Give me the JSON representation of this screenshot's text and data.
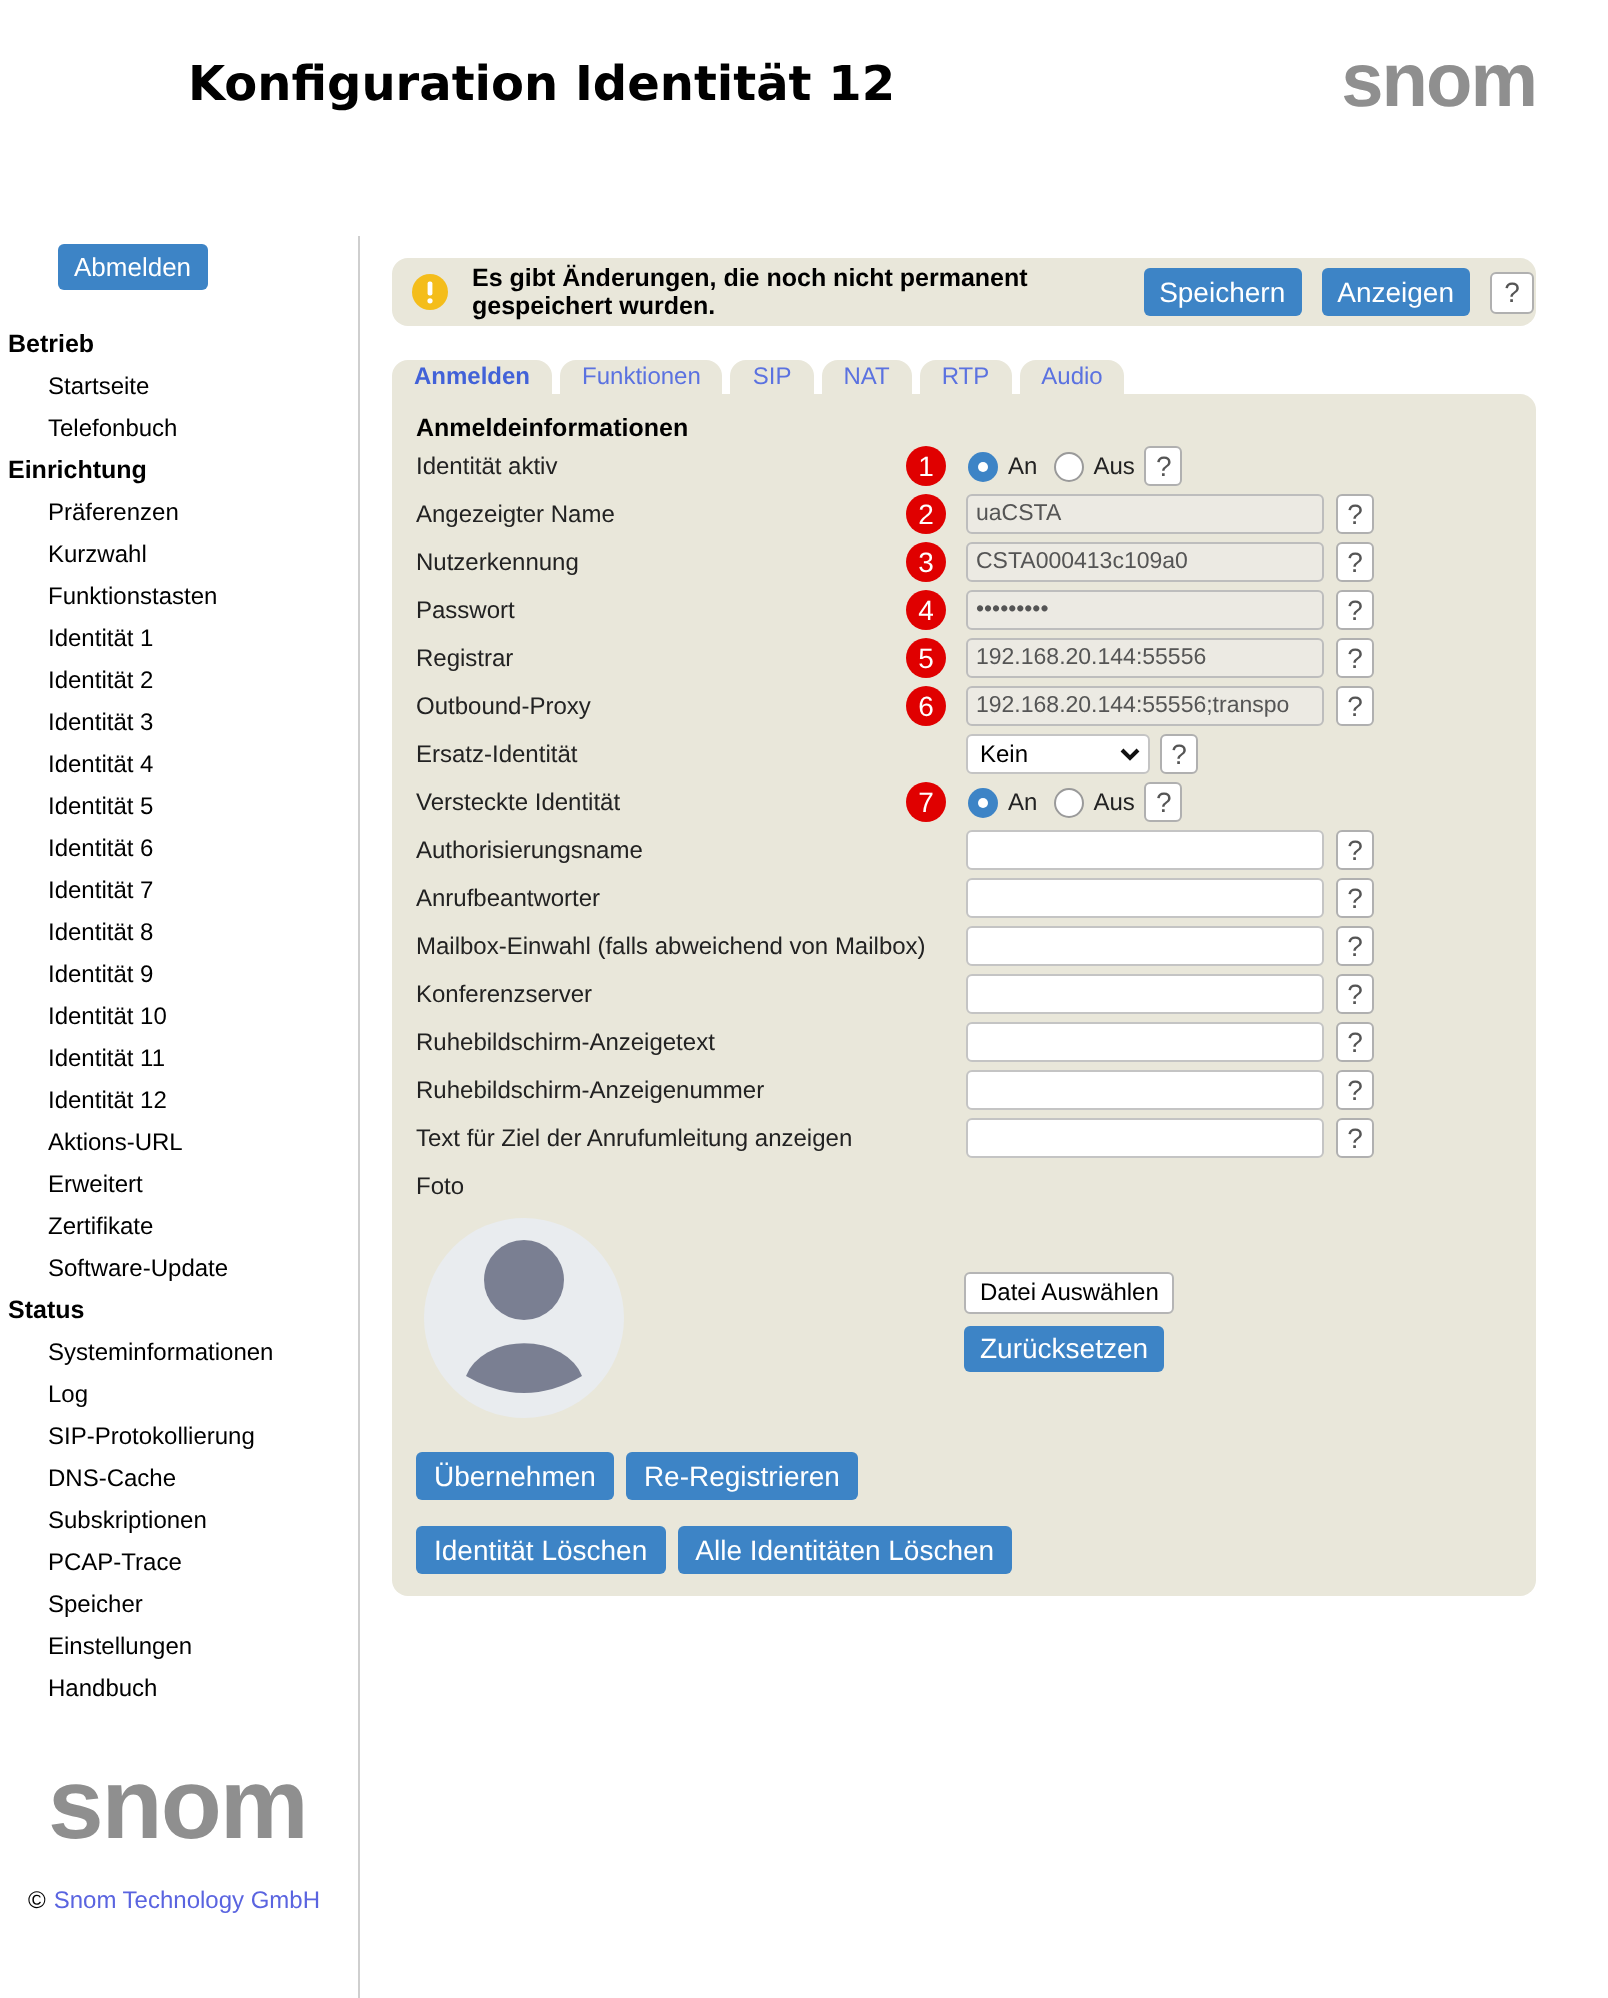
{
  "header": {
    "title": "Konfiguration Identität 12",
    "logo": "snom"
  },
  "sidebar": {
    "logout_button": "Abmelden",
    "sections": [
      {
        "title": "Betrieb",
        "items": [
          "Startseite",
          "Telefonbuch"
        ]
      },
      {
        "title": "Einrichtung",
        "items": [
          "Präferenzen",
          "Kurzwahl",
          "Funktionstasten",
          "Identität 1",
          "Identität 2",
          "Identität 3",
          "Identität 4",
          "Identität 5",
          "Identität 6",
          "Identität 7",
          "Identität 8",
          "Identität 9",
          "Identität 10",
          "Identität 11",
          "Identität 12",
          "Aktions-URL",
          "Erweitert",
          "Zertifikate",
          "Software-Update"
        ]
      },
      {
        "title": "Status",
        "items": [
          "Systeminformationen",
          "Log",
          "SIP-Protokollierung",
          "DNS-Cache",
          "Subskriptionen",
          "PCAP-Trace",
          "Speicher",
          "Einstellungen",
          "Handbuch"
        ]
      }
    ],
    "logo": "snom",
    "copyright": {
      "symbol": "©",
      "link": "Snom Technology GmbH"
    }
  },
  "notice": {
    "message": "Es gibt Änderungen, die noch nicht permanent gespeichert wurden.",
    "buttons": [
      "Speichern",
      "Anzeigen"
    ],
    "help": "?"
  },
  "tabs": [
    {
      "label": "Anmelden",
      "selected": true
    },
    {
      "label": "Funktionen",
      "selected": false
    },
    {
      "label": "SIP",
      "selected": false
    },
    {
      "label": "NAT",
      "selected": false
    },
    {
      "label": "RTP",
      "selected": false
    },
    {
      "label": "Audio",
      "selected": false
    }
  ],
  "panel": {
    "heading": "Anmeldeinformationen",
    "rows": [
      {
        "kind": "radio",
        "label": "Identität aktiv",
        "badge": "1",
        "options": [
          {
            "label": "An",
            "selected": true
          },
          {
            "label": "Aus",
            "selected": false
          }
        ],
        "help": "?"
      },
      {
        "kind": "text",
        "label": "Angezeigter Name",
        "badge": "2",
        "value": "uaCSTA",
        "disabled": true,
        "help": "?"
      },
      {
        "kind": "text",
        "label": "Nutzerkennung",
        "badge": "3",
        "value": "CSTA000413c109a0",
        "disabled": true,
        "help": "?"
      },
      {
        "kind": "text",
        "label": "Passwort",
        "badge": "4",
        "value": "•••••••••",
        "disabled": true,
        "help": "?"
      },
      {
        "kind": "text",
        "label": "Registrar",
        "badge": "5",
        "value": "192.168.20.144:55556",
        "disabled": true,
        "help": "?"
      },
      {
        "kind": "text",
        "label": "Outbound-Proxy",
        "badge": "6",
        "value": "192.168.20.144:55556;transpo",
        "disabled": true,
        "help": "?"
      },
      {
        "kind": "select",
        "label": "Ersatz-Identität",
        "value": "Kein",
        "help": "?"
      },
      {
        "kind": "radio",
        "label": "Versteckte Identität",
        "badge": "7",
        "options": [
          {
            "label": "An",
            "selected": true
          },
          {
            "label": "Aus",
            "selected": false
          }
        ],
        "help": "?"
      },
      {
        "kind": "text",
        "label": "Authorisierungsname",
        "disabled": false,
        "help": "?"
      },
      {
        "kind": "text",
        "label": "Anrufbeantworter",
        "disabled": false,
        "help": "?"
      },
      {
        "kind": "text",
        "label": "Mailbox-Einwahl (falls abweichend von Mailbox)",
        "disabled": false,
        "help": "?"
      },
      {
        "kind": "text",
        "label": "Konferenzserver",
        "disabled": false,
        "help": "?"
      },
      {
        "kind": "text",
        "label": "Ruhebildschirm-Anzeigetext",
        "disabled": false,
        "help": "?"
      },
      {
        "kind": "text",
        "label": "Ruhebildschirm-Anzeigenummer",
        "disabled": false,
        "help": "?"
      },
      {
        "kind": "text",
        "label": "Text für Ziel der Anrufumleitung anzeigen",
        "disabled": false,
        "help": "?"
      }
    ],
    "photo": {
      "label": "Foto",
      "choose_button": "Datei Auswählen",
      "reset_button": "Zurücksetzen"
    },
    "button_rows": [
      [
        "Übernehmen",
        "Re-Registrieren"
      ],
      [
        "Identität Löschen",
        "Alle Identitäten Löschen"
      ]
    ]
  }
}
